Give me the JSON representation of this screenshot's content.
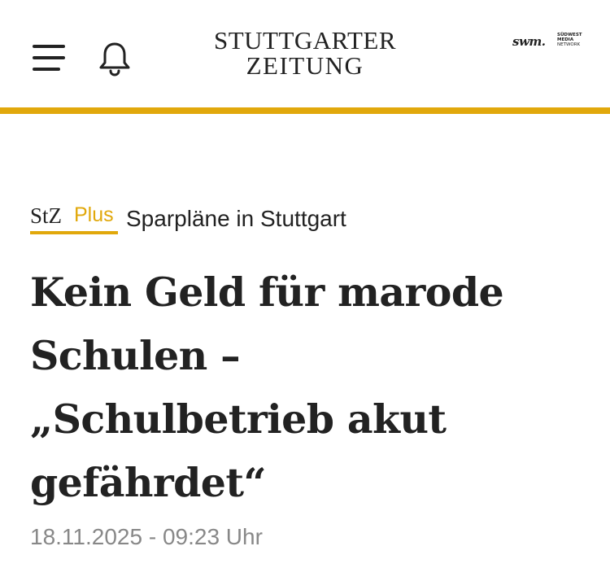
{
  "header": {
    "logo_line1": "STUTTGARTER",
    "logo_line2": "ZEITUNG",
    "partner_mark": "swm.",
    "partner_line1": "SÜDWEST",
    "partner_line2": "MEDIA",
    "partner_line3": "NETWORK",
    "menu_icon": "hamburger-menu-icon",
    "notification_icon": "bell-icon"
  },
  "colors": {
    "accent": "#e1a80b",
    "text": "#222222",
    "meta": "#888888"
  },
  "article": {
    "badge_stz": "StZ",
    "badge_plus": "Plus",
    "kicker": "Sparpläne in Stuttgart",
    "headline_line1": "Kein Geld für marode",
    "headline_line2": "Schulen –",
    "headline_line3": "„Schulbetrieb akut",
    "headline_line4": "gefährdet“",
    "date": "18.11.2025 - 09:23 Uhr"
  }
}
